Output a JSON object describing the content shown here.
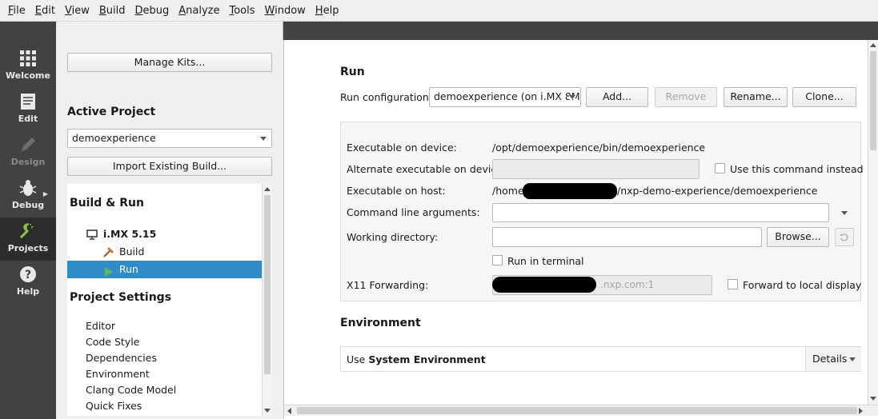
{
  "menu": [
    {
      "label": "File",
      "key": "F",
      "rest": "ile"
    },
    {
      "label": "Edit",
      "key": "E",
      "rest": "dit"
    },
    {
      "label": "View",
      "key": "V",
      "rest": "iew"
    },
    {
      "label": "Build",
      "key": "B",
      "rest": "uild"
    },
    {
      "label": "Debug",
      "key": "D",
      "rest": "ebug"
    },
    {
      "label": "Analyze",
      "key": "A",
      "rest": "nalyze"
    },
    {
      "label": "Tools",
      "key": "T",
      "rest": "ools"
    },
    {
      "label": "Window",
      "key": "W",
      "rest": "indow"
    },
    {
      "label": "Help",
      "key": "H",
      "rest": "elp"
    }
  ],
  "modes": {
    "welcome": "Welcome",
    "edit": "Edit",
    "design": "Design",
    "debug": "Debug",
    "projects": "Projects",
    "help": "Help"
  },
  "left": {
    "manage_kits": "Manage Kits...",
    "active_project_heading": "Active Project",
    "active_project": "demoexperience",
    "import_build": "Import Existing Build...",
    "build_run_heading": "Build & Run",
    "kit_name": "i.MX 5.15",
    "build_item": "Build",
    "run_item": "Run",
    "project_settings_heading": "Project Settings",
    "settings": [
      "Editor",
      "Code Style",
      "Dependencies",
      "Environment",
      "Clang Code Model",
      "Quick Fixes"
    ]
  },
  "run": {
    "heading": "Run",
    "config_label": "Run configuration:",
    "config_value": "demoexperience (on i.MX 8M",
    "add": "Add...",
    "remove": "Remove",
    "rename": "Rename...",
    "clone": "Clone...",
    "exec_device_label": "Executable on device:",
    "exec_device_value": "/opt/demoexperience/bin/demoexperience",
    "alt_exec_label": "Alternate executable on device:",
    "use_cmd_label": "Use this command instead",
    "exec_host_label": "Executable on host:",
    "exec_host_prefix": "/home",
    "exec_host_suffix": "/nxp-demo-experience/demoexperience",
    "cmd_args_label": "Command line arguments:",
    "work_dir_label": "Working directory:",
    "browse": "Browse...",
    "run_terminal_label": "Run in terminal",
    "x11_label": "X11 Forwarding:",
    "x11_value": ".nxp.com:1",
    "forward_local_label": "Forward to local display"
  },
  "environment": {
    "heading": "Environment",
    "use_prefix": "Use",
    "use_value": "System Environment",
    "details": "Details"
  },
  "colors": {
    "accent": "#308cc6",
    "modebar": "#404244",
    "projects_icon": "#8bc34a"
  }
}
